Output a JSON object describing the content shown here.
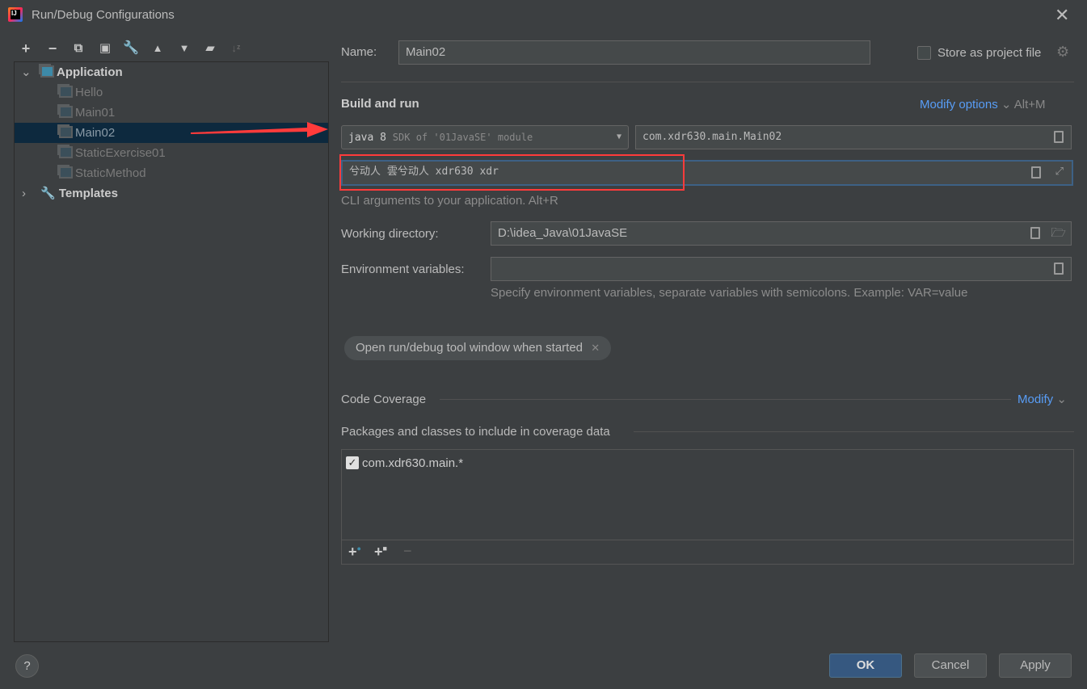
{
  "window": {
    "title": "Run/Debug Configurations",
    "app_icon": "intellij-icon",
    "close_icon": "close-icon"
  },
  "toolbar": [
    "add-icon",
    "remove-icon",
    "copy-icon",
    "save-icon",
    "wrench-icon",
    "move-up-icon",
    "move-down-icon",
    "new-folder-icon",
    "sort-icon"
  ],
  "tree": {
    "application": "Application",
    "items": [
      "Hello",
      "Main01",
      "Main02",
      "StaticExercise01",
      "StaticMethod"
    ],
    "selected": "Main02",
    "templates": "Templates"
  },
  "form": {
    "name_label": "Name:",
    "name_value": "Main02",
    "store_label": "Store as project file",
    "store_checked": false,
    "section_build": "Build and run",
    "modify_options": "Modify options",
    "modify_shortcut": "Alt+M",
    "sdk_main": "java 8",
    "sdk_detail": "SDK of '01JavaSE' module",
    "main_class": "com.xdr630.main.Main02",
    "program_args": "兮动人 雲兮动人 xdr630 xdr",
    "args_hint": "CLI arguments to your application. Alt+R",
    "workdir_label": "Working directory:",
    "workdir_value": "D:\\idea_Java\\01JavaSE",
    "env_label": "Environment variables:",
    "env_value": "",
    "env_hint": "Specify environment variables, separate variables with semicolons. Example: VAR=value",
    "chip": "Open run/debug tool window when started",
    "coverage_label": "Code Coverage",
    "coverage_modify": "Modify",
    "packages_label": "Packages and classes to include in coverage data",
    "package_item": "com.xdr630.main.*",
    "package_checked": true
  },
  "buttons": {
    "ok": "OK",
    "cancel": "Cancel",
    "apply": "Apply",
    "help": "?"
  },
  "colors": {
    "accent": "#589df6",
    "selection": "#0d293e",
    "annotation": "#ff3b3b",
    "ok": "#365880"
  }
}
